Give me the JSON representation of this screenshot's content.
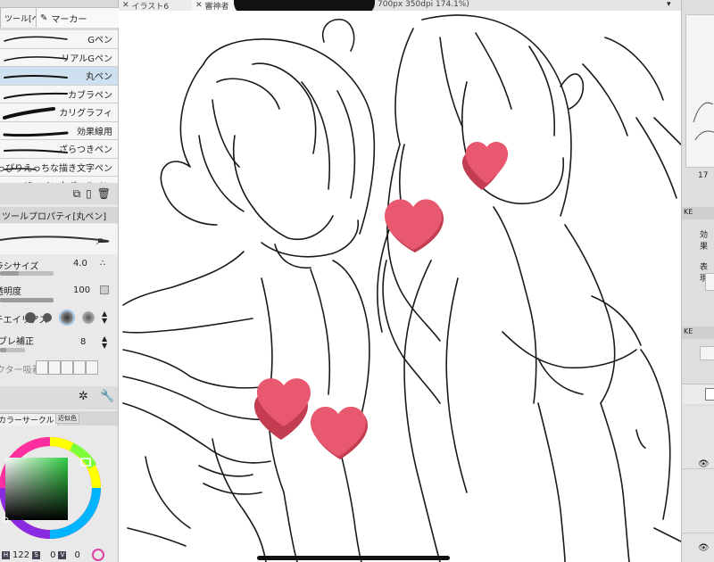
{
  "tool_tabs": {
    "tool_tab_label": "ツール[ペン]",
    "marker_tab_label": "マーカー"
  },
  "brushes": [
    {
      "label": "Gペン",
      "selected": false
    },
    {
      "label": "リアルGペン",
      "selected": false
    },
    {
      "label": "丸ペン",
      "selected": true
    },
    {
      "label": "カブラペン",
      "selected": false
    },
    {
      "label": "カリグラフィ",
      "selected": false
    },
    {
      "label": "効果線用",
      "selected": false
    },
    {
      "label": "ざらつきペン",
      "selected": false
    },
    {
      "label": "っぴりえっちな描き文字ペン",
      "selected": false
    },
    {
      "label": "ザ・インクボールペン",
      "selected": false
    }
  ],
  "tool_property": {
    "header": "ツールプロパティ[丸ペン]",
    "size_label": "ブラシサイズ",
    "size_value": "4.0",
    "size_fraction": 0.35,
    "opacity_label": "不透明度",
    "opacity_value": "100",
    "opacity_fraction": 1.0,
    "antialias_label": "アンチエイリアス",
    "stabilize_label": "手ブレ補正",
    "stabilize_value": "8",
    "stabilize_fraction": 0.25,
    "vector_snap_label": "ベクター吸着"
  },
  "color": {
    "tab_label": "カラーサークル",
    "tab2_label": "近似色",
    "h_label": "H",
    "h_value": "122",
    "s_label": "S",
    "s_value": "0",
    "v_label": "V",
    "v_value": "0",
    "current_color": "#2ecc40"
  },
  "document": {
    "tab1_label": "イラスト6",
    "tab2_label": "審神者",
    "info": "700px 350dpi 174.1%)"
  },
  "right_panel": {
    "nav_value": "17",
    "effect_label": "効果",
    "expression_label": "表現"
  },
  "colors": {
    "heart": "#e8586e",
    "heart_shadow": "#c33d52",
    "line": "#1a1a1a"
  }
}
